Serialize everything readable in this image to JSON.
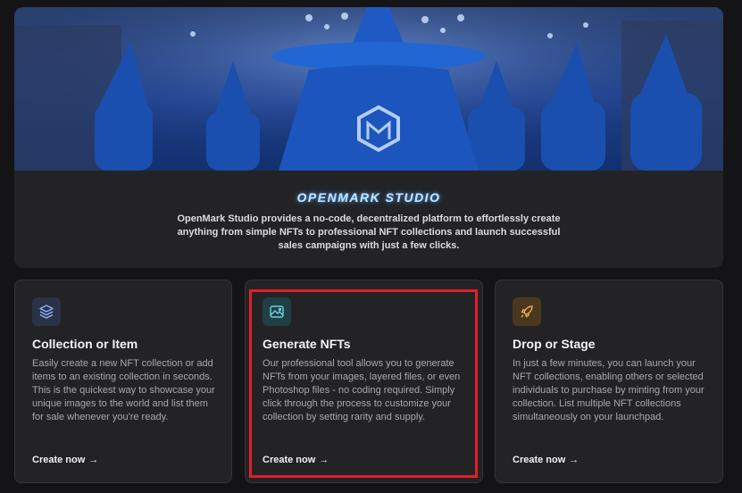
{
  "hero": {
    "brand": "OPENMARK STUDIO",
    "tagline": "OpenMark Studio provides a no-code, decentralized platform to effortlessly create anything from simple NFTs to professional NFT collections and launch successful sales campaigns with just a few clicks."
  },
  "cards": [
    {
      "icon": "layers-icon",
      "icon_bg": "#2a3247",
      "icon_color": "#8fb0ff",
      "title": "Collection or Item",
      "description": "Easily create a new NFT collection or add items to an existing collection in seconds. This is the quickest way to showcase your unique images to the world and list them for sale whenever you're ready.",
      "cta": "Create now",
      "cta_arrow": "→"
    },
    {
      "icon": "image-icon",
      "icon_bg": "#1f3f45",
      "icon_color": "#6fd0d8",
      "title": "Generate NFTs",
      "description": "Our professional tool allows you to generate NFTs from your images, layered files, or even Photoshop files - no coding required. Simply click through the process to customize your collection by setting rarity and supply.",
      "cta": "Create now",
      "cta_arrow": "→"
    },
    {
      "icon": "rocket-icon",
      "icon_bg": "#4a3820",
      "icon_color": "#f0b050",
      "title": "Drop or Stage",
      "description": "In just a few minutes, you can launch your NFT collections, enabling others or selected individuals to purchase by minting from your collection. List multiple NFT collections simultaneously on your launchpad.",
      "cta": "Create now",
      "cta_arrow": "→"
    }
  ],
  "highlight_color": "#e0202a"
}
